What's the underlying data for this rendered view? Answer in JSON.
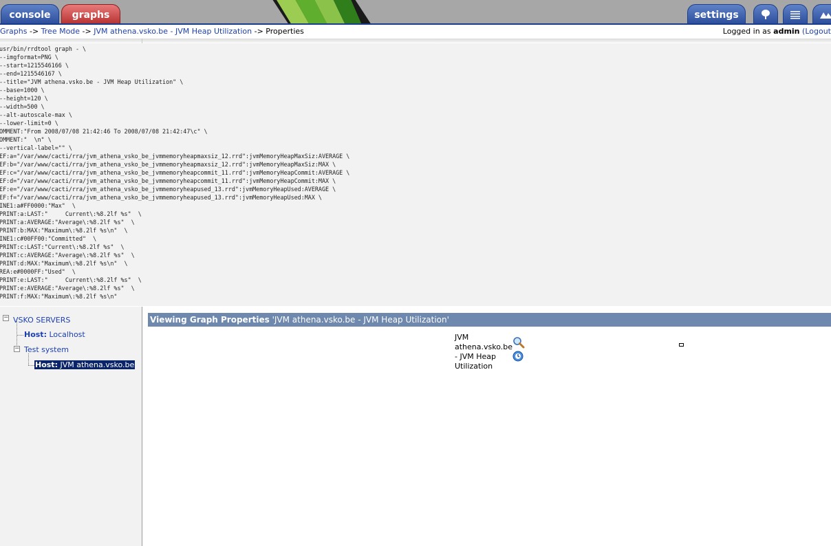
{
  "nav": {
    "tabs": {
      "console": "console",
      "graphs": "graphs",
      "settings": "settings"
    },
    "tab_icons": [
      "tree-view-icon",
      "list-view-icon",
      "preview-icon"
    ]
  },
  "breadcrumb": {
    "items": [
      "Graphs",
      "Tree Mode",
      "JVM athena.vsko.be - JVM Heap Utilization"
    ],
    "separator": " -> ",
    "current": "Properties"
  },
  "login": {
    "prefix": "Logged in as ",
    "user": "admin",
    "logout": "(Logout"
  },
  "rrd_command": "/usr/bin/rrdtool graph - \\\n --imgformat=PNG \\\n --start=1215546166 \\\n --end=1215546167 \\\n --title=\"JVM athena.vsko.be - JVM Heap Utilization\" \\\n --base=1000 \\\n --height=120 \\\n --width=500 \\\n --alt-autoscale-max \\\n --lower-limit=0 \\\nCOMMENT:\"From 2008/07/08 21:42:46 To 2008/07/08 21:42:47\\c\" \\\nCOMMENT:\"  \\n\" \\\n --vertical-label=\"\" \\\nDEF:a=\"/var/www/cacti/rra/jvm_athena_vsko_be_jvmmemoryheapmaxsiz_12.rrd\":jvmMemoryHeapMaxSiz:AVERAGE \\\nDEF:b=\"/var/www/cacti/rra/jvm_athena_vsko_be_jvmmemoryheapmaxsiz_12.rrd\":jvmMemoryHeapMaxSiz:MAX \\\nDEF:c=\"/var/www/cacti/rra/jvm_athena_vsko_be_jvmmemoryheapcommit_11.rrd\":jvmMemoryHeapCommit:AVERAGE \\\nDEF:d=\"/var/www/cacti/rra/jvm_athena_vsko_be_jvmmemoryheapcommit_11.rrd\":jvmMemoryHeapCommit:MAX \\\nDEF:e=\"/var/www/cacti/rra/jvm_athena_vsko_be_jvmmemoryheapused_13.rrd\":jvmMemoryHeapUsed:AVERAGE \\\nDEF:f=\"/var/www/cacti/rra/jvm_athena_vsko_be_jvmmemoryheapused_13.rrd\":jvmMemoryHeapUsed:MAX \\\nLINE1:a#FF0000:\"Max\"  \\\nGPRINT:a:LAST:\"     Current\\:%8.2lf %s\"  \\\nGPRINT:a:AVERAGE:\"Average\\:%8.2lf %s\"  \\\nGPRINT:b:MAX:\"Maximum\\:%8.2lf %s\\n\"  \\\nLINE1:c#00FF00:\"Committed\"  \\\nGPRINT:c:LAST:\"Current\\:%8.2lf %s\"  \\\nGPRINT:c:AVERAGE:\"Average\\:%8.2lf %s\"  \\\nGPRINT:d:MAX:\"Maximum\\:%8.2lf %s\\n\"  \\\nAREA:e#0000FF:\"Used\"  \\\nGPRINT:e:LAST:\"     Current\\:%8.2lf %s\"  \\\nGPRINT:e:AVERAGE:\"Average\\:%8.2lf %s\"  \\\nGPRINT:f:MAX:\"Maximum\\:%8.2lf %s\\n\"",
  "tree": {
    "root": "VSKO SERVERS",
    "host1": {
      "prefix": "Host:",
      "name": "Localhost"
    },
    "group": "Test system",
    "host2": {
      "prefix": "Host:",
      "name": "JVM athena.vsko.be"
    }
  },
  "main": {
    "header_bold": "Viewing Graph Properties",
    "header_rest": " 'JVM athena.vsko.be - JVM Heap Utilization'",
    "graph_title": "JVM athena.vsko.be - JVM Heap Utilization",
    "icons": [
      "zoom-icon",
      "graph-properties-icon"
    ]
  },
  "colors": {
    "tab_blue": "#2e509d",
    "tab_red": "#b83434",
    "header_bg": "#6e88ae",
    "link": "#1c3fb0",
    "selection": "#0a246a"
  }
}
